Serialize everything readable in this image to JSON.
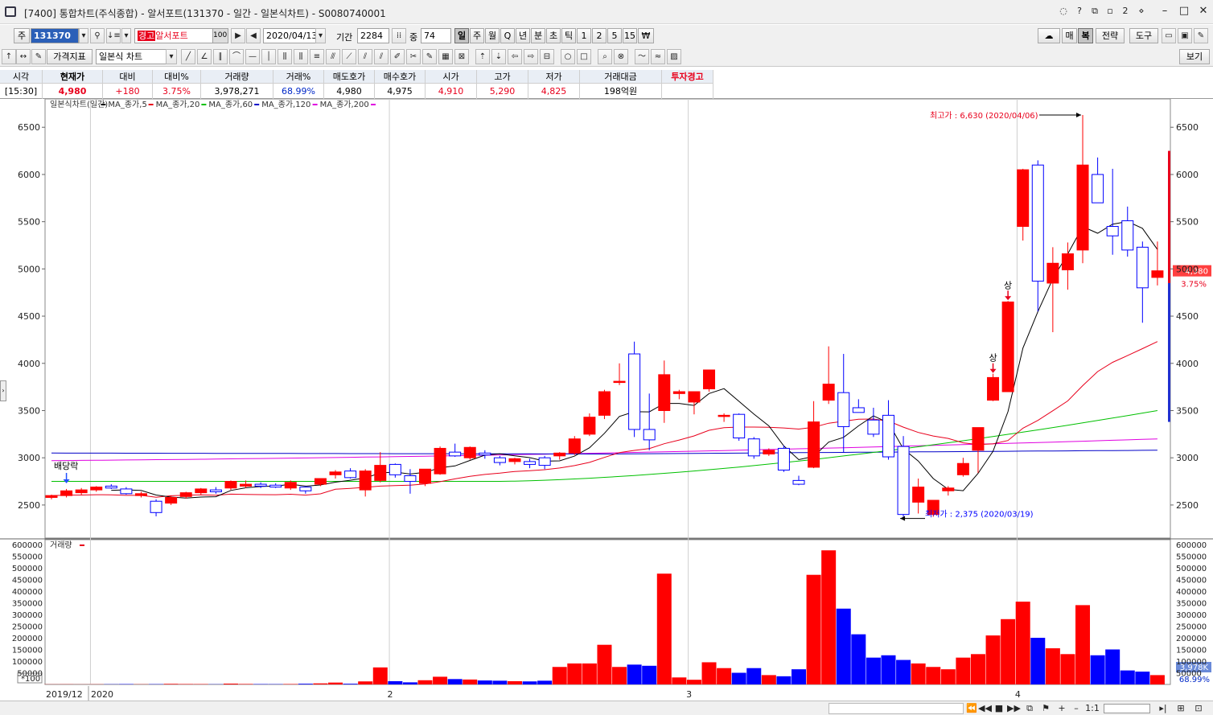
{
  "window": {
    "title": "[7400] 통합차트(주식종합) - 알서포트(131370 - 일간 - 일본식차트) - S0080740001"
  },
  "toolbar1": {
    "market_label": "주",
    "code": "131370",
    "warn_badge": "경고",
    "stock_name": "알서포트",
    "percent_box": "100",
    "date": "2020/04/13",
    "period_label": "기간",
    "period_value": "2284",
    "count_label": "중",
    "count_value": "74",
    "periods": [
      "일",
      "주",
      "월",
      "Q",
      "년",
      "분",
      "초",
      "틱",
      "1",
      "2",
      "5",
      "15",
      "₩"
    ],
    "selected_period": "일",
    "right_buttons": [
      "매",
      "복",
      "전략",
      "도구"
    ]
  },
  "toolbar2": {
    "indicator_button": "가격지표",
    "chart_type": "일본식 차트",
    "view_button": "보기"
  },
  "quote": {
    "headers": [
      "시각",
      "현재가",
      "대비",
      "대비%",
      "거래량",
      "거래%",
      "매도호가",
      "매수호가",
      "시가",
      "고가",
      "저가",
      "거래대금",
      "투자경고"
    ],
    "values": [
      "[15:30]",
      "4,980",
      "+180",
      "3.75%",
      "3,978,271",
      "68.99%",
      "4,980",
      "4,975",
      "4,910",
      "5,290",
      "4,825",
      "198억원",
      ""
    ]
  },
  "chart": {
    "legend_price": [
      {
        "label": "일본식차트(일간)",
        "color": "#e8001c"
      },
      {
        "label": "MA_종가,5",
        "color": "#000000"
      },
      {
        "label": "MA_종가,20",
        "color": "#e8001c"
      },
      {
        "label": "MA_종가,60",
        "color": "#00c000"
      },
      {
        "label": "MA_종가,120",
        "color": "#0000c8"
      },
      {
        "label": "MA_종가,200",
        "color": "#e000e0"
      }
    ],
    "legend_volume": "거래량",
    "max_label": "최고가 : 6,630 (2020/04/06)",
    "min_label": "최저가 : 2,375 (2020/03/19)",
    "dividend_label": "배당락",
    "limit_up_marker": "상",
    "current_price_tag": "4,980",
    "current_change_tag": "3.75%",
    "volume_tag": "3,978K",
    "volume_pct_tag": "68.99%",
    "volume_unit": "*100",
    "date_labels": [
      "2019/12",
      "2020",
      "2",
      "3",
      "4"
    ],
    "price_ticks": [
      "6500",
      "6000",
      "5500",
      "5000",
      "4500",
      "4000",
      "3500",
      "3000",
      "2500"
    ],
    "volume_ticks": [
      "600000",
      "550000",
      "500000",
      "450000",
      "400000",
      "350000",
      "300000",
      "250000",
      "200000",
      "150000",
      "100000",
      "50000"
    ]
  },
  "chart_data": {
    "type": "candlestick",
    "x_range": [
      "2019/12",
      "2020/04/13"
    ],
    "ylim_price": [
      2150,
      6800
    ],
    "ylim_volume": [
      0,
      600000
    ],
    "highest": {
      "value": 6630,
      "date": "2020/04/06"
    },
    "lowest": {
      "value": 2375,
      "date": "2020/03/19"
    },
    "candles": [
      {
        "o": 2580,
        "h": 2610,
        "l": 2560,
        "c": 2600,
        "v": 600
      },
      {
        "o": 2600,
        "h": 2670,
        "l": 2580,
        "c": 2650,
        "v": 800
      },
      {
        "o": 2630,
        "h": 2680,
        "l": 2610,
        "c": 2660,
        "v": 500
      },
      {
        "o": 2660,
        "h": 2700,
        "l": 2640,
        "c": 2690,
        "v": 700
      },
      {
        "o": 2700,
        "h": 2720,
        "l": 2670,
        "c": 2680,
        "v": 900
      },
      {
        "o": 2670,
        "h": 2690,
        "l": 2610,
        "c": 2620,
        "v": 1500
      },
      {
        "o": 2600,
        "h": 2640,
        "l": 2580,
        "c": 2620,
        "v": 800
      },
      {
        "o": 2540,
        "h": 2560,
        "l": 2380,
        "c": 2420,
        "v": 1200
      },
      {
        "o": 2520,
        "h": 2600,
        "l": 2500,
        "c": 2580,
        "v": 2500
      },
      {
        "o": 2590,
        "h": 2640,
        "l": 2570,
        "c": 2630,
        "v": 1800
      },
      {
        "o": 2630,
        "h": 2680,
        "l": 2610,
        "c": 2670,
        "v": 1500
      },
      {
        "o": 2660,
        "h": 2690,
        "l": 2620,
        "c": 2640,
        "v": 800
      },
      {
        "o": 2680,
        "h": 2760,
        "l": 2660,
        "c": 2750,
        "v": 3500
      },
      {
        "o": 2700,
        "h": 2760,
        "l": 2680,
        "c": 2720,
        "v": 2000
      },
      {
        "o": 2720,
        "h": 2740,
        "l": 2680,
        "c": 2700,
        "v": 1500
      },
      {
        "o": 2710,
        "h": 2730,
        "l": 2680,
        "c": 2690,
        "v": 1200
      },
      {
        "o": 2680,
        "h": 2760,
        "l": 2660,
        "c": 2740,
        "v": 1800
      },
      {
        "o": 2690,
        "h": 2700,
        "l": 2620,
        "c": 2650,
        "v": 3000
      },
      {
        "o": 2720,
        "h": 2780,
        "l": 2700,
        "c": 2780,
        "v": 4500
      },
      {
        "o": 2820,
        "h": 2870,
        "l": 2780,
        "c": 2850,
        "v": 8000
      },
      {
        "o": 2860,
        "h": 2890,
        "l": 2780,
        "c": 2790,
        "v": 3000
      },
      {
        "o": 2660,
        "h": 2880,
        "l": 2590,
        "c": 2860,
        "v": 13000
      },
      {
        "o": 2760,
        "h": 3060,
        "l": 2740,
        "c": 2920,
        "v": 73000
      },
      {
        "o": 2930,
        "h": 2940,
        "l": 2790,
        "c": 2820,
        "v": 14000
      },
      {
        "o": 2810,
        "h": 2880,
        "l": 2620,
        "c": 2750,
        "v": 9000
      },
      {
        "o": 2730,
        "h": 2880,
        "l": 2700,
        "c": 2880,
        "v": 18000
      },
      {
        "o": 2830,
        "h": 3120,
        "l": 2820,
        "c": 3100,
        "v": 33000
      },
      {
        "o": 3060,
        "h": 3150,
        "l": 3010,
        "c": 3020,
        "v": 23000
      },
      {
        "o": 3000,
        "h": 3120,
        "l": 2980,
        "c": 3110,
        "v": 21000
      },
      {
        "o": 3050,
        "h": 3080,
        "l": 2990,
        "c": 3030,
        "v": 17000
      },
      {
        "o": 3000,
        "h": 3020,
        "l": 2920,
        "c": 2950,
        "v": 16000
      },
      {
        "o": 2960,
        "h": 3000,
        "l": 2930,
        "c": 2990,
        "v": 14000
      },
      {
        "o": 2960,
        "h": 2990,
        "l": 2890,
        "c": 2930,
        "v": 13000
      },
      {
        "o": 3000,
        "h": 3020,
        "l": 2880,
        "c": 2920,
        "v": 16000
      },
      {
        "o": 3020,
        "h": 3060,
        "l": 2980,
        "c": 3050,
        "v": 75000
      },
      {
        "o": 3050,
        "h": 3230,
        "l": 3030,
        "c": 3200,
        "v": 90000
      },
      {
        "o": 3250,
        "h": 3470,
        "l": 3230,
        "c": 3430,
        "v": 90000
      },
      {
        "o": 3450,
        "h": 3720,
        "l": 3410,
        "c": 3700,
        "v": 170000
      },
      {
        "o": 3800,
        "h": 4000,
        "l": 3770,
        "c": 3810,
        "v": 75000
      },
      {
        "o": 4100,
        "h": 4230,
        "l": 3220,
        "c": 3300,
        "v": 85000
      },
      {
        "o": 3300,
        "h": 3680,
        "l": 3080,
        "c": 3190,
        "v": 80000
      },
      {
        "o": 3500,
        "h": 4030,
        "l": 3370,
        "c": 3880,
        "v": 475000
      },
      {
        "o": 3680,
        "h": 3720,
        "l": 3620,
        "c": 3700,
        "v": 30000
      },
      {
        "o": 3590,
        "h": 3700,
        "l": 3460,
        "c": 3700,
        "v": 20000
      },
      {
        "o": 3730,
        "h": 3930,
        "l": 3700,
        "c": 3930,
        "v": 95000
      },
      {
        "o": 3440,
        "h": 3470,
        "l": 3380,
        "c": 3450,
        "v": 70000
      },
      {
        "o": 3460,
        "h": 3470,
        "l": 3180,
        "c": 3210,
        "v": 50000
      },
      {
        "o": 3200,
        "h": 3220,
        "l": 2990,
        "c": 3020,
        "v": 70000
      },
      {
        "o": 3040,
        "h": 3100,
        "l": 3020,
        "c": 3080,
        "v": 40000
      },
      {
        "o": 3100,
        "h": 3130,
        "l": 2850,
        "c": 2870,
        "v": 35000
      },
      {
        "o": 2760,
        "h": 2810,
        "l": 2710,
        "c": 2720,
        "v": 65000
      },
      {
        "o": 2900,
        "h": 3600,
        "l": 2890,
        "c": 3380,
        "v": 470000
      },
      {
        "o": 3610,
        "h": 4180,
        "l": 3570,
        "c": 3780,
        "v": 575000
      },
      {
        "o": 3690,
        "h": 4100,
        "l": 3060,
        "c": 3330,
        "v": 325000
      },
      {
        "o": 3530,
        "h": 3620,
        "l": 3480,
        "c": 3480,
        "v": 215000
      },
      {
        "o": 3400,
        "h": 3530,
        "l": 3220,
        "c": 3250,
        "v": 115000
      },
      {
        "o": 3450,
        "h": 3610,
        "l": 2980,
        "c": 3010,
        "v": 125000
      },
      {
        "o": 3120,
        "h": 3230,
        "l": 2375,
        "c": 2400,
        "v": 105000
      },
      {
        "o": 2530,
        "h": 2780,
        "l": 2410,
        "c": 2690,
        "v": 90000
      },
      {
        "o": 2400,
        "h": 2550,
        "l": 2375,
        "c": 2550,
        "v": 75000
      },
      {
        "o": 2650,
        "h": 2700,
        "l": 2600,
        "c": 2680,
        "v": 65000
      },
      {
        "o": 2820,
        "h": 3000,
        "l": 2800,
        "c": 2940,
        "v": 115000
      },
      {
        "o": 3080,
        "h": 3290,
        "l": 2840,
        "c": 3320,
        "v": 130000
      },
      {
        "o": 3610,
        "h": 3890,
        "l": 3600,
        "c": 3850,
        "v": 210000
      },
      {
        "o": 3700,
        "h": 4660,
        "l": 3700,
        "c": 4650,
        "v": 280000
      },
      {
        "o": 5450,
        "h": 6060,
        "l": 5300,
        "c": 6050,
        "v": 355000
      },
      {
        "o": 6100,
        "h": 6150,
        "l": 4550,
        "c": 4870,
        "v": 200000
      },
      {
        "o": 4850,
        "h": 5230,
        "l": 4330,
        "c": 5060,
        "v": 155000
      },
      {
        "o": 4990,
        "h": 5280,
        "l": 4780,
        "c": 5160,
        "v": 130000
      },
      {
        "o": 5200,
        "h": 6630,
        "l": 5060,
        "c": 6100,
        "v": 340000
      },
      {
        "o": 6000,
        "h": 6180,
        "l": 5700,
        "c": 5700,
        "v": 125000
      },
      {
        "o": 5450,
        "h": 6060,
        "l": 5150,
        "c": 5350,
        "v": 150000
      },
      {
        "o": 5510,
        "h": 5660,
        "l": 5130,
        "c": 5200,
        "v": 60000
      },
      {
        "o": 5230,
        "h": 5290,
        "l": 4430,
        "c": 4800,
        "v": 55000
      },
      {
        "o": 4910,
        "h": 5290,
        "l": 4825,
        "c": 4980,
        "v": 40000
      }
    ],
    "moving_averages": {
      "MA_종가,20": [
        2600,
        4200
      ],
      "MA_종가,60": [
        2750,
        3500
      ],
      "MA_종가,120": [
        3050,
        3100
      ],
      "MA_종가,200": [
        2970,
        3200
      ]
    }
  }
}
